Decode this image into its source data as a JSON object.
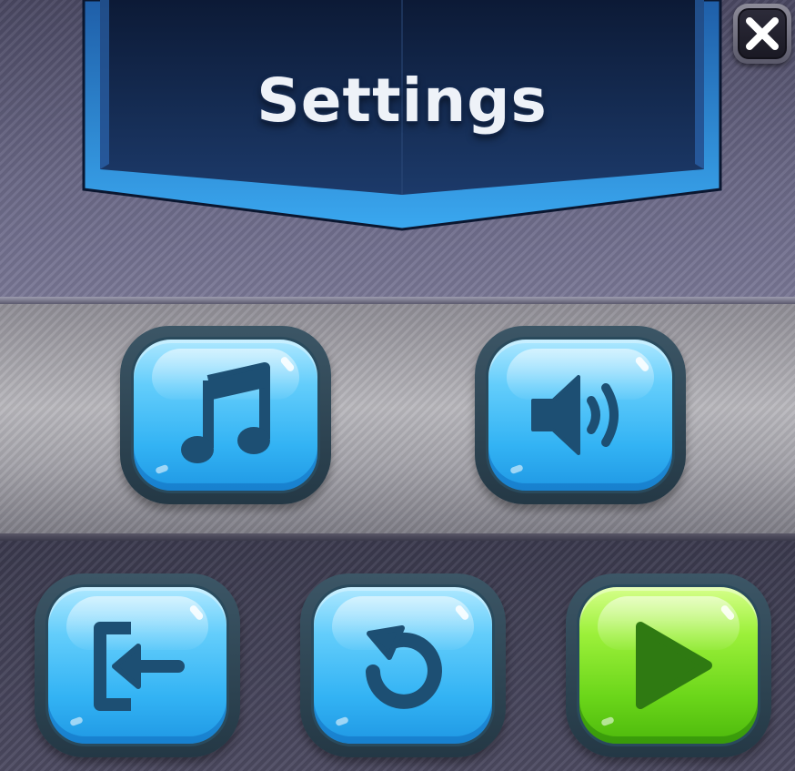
{
  "dialog": {
    "title": "Settings",
    "close_glyph": "X"
  },
  "buttons": {
    "music": {
      "icon": "music-note-icon"
    },
    "sound": {
      "icon": "speaker-volume-icon"
    },
    "exit": {
      "icon": "exit-door-arrow-icon"
    },
    "replay": {
      "icon": "restart-arrow-icon"
    },
    "play": {
      "icon": "play-triangle-icon"
    }
  },
  "colors": {
    "banner": "#13294f",
    "banner_trim": "#2f8fe0",
    "button_blue": "#33b3f4",
    "button_green": "#6bd61a",
    "icon_dark": "#1d4f73",
    "icon_dark_green": "#2f7a12"
  }
}
